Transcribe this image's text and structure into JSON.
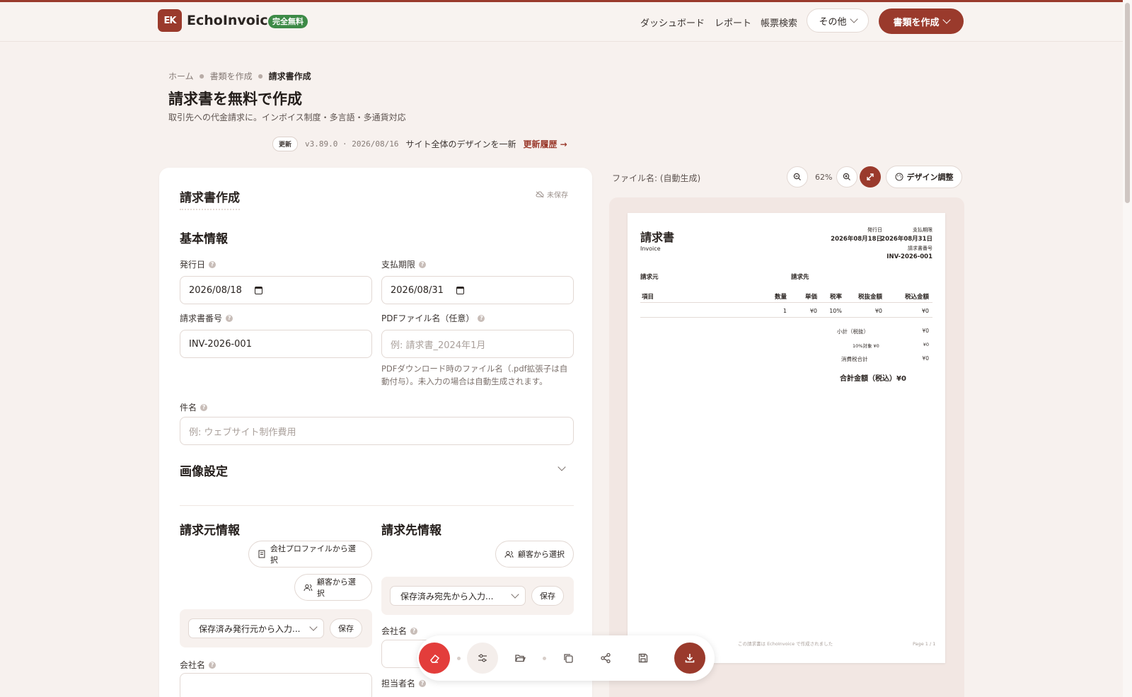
{
  "header": {
    "logo_mark": "EK",
    "brand": "EchoInvoice",
    "free_badge": "完全無料",
    "nav": [
      "ダッシュボード",
      "レポート",
      "帳票検索"
    ],
    "other_label": "その他",
    "create_label": "書類を作成"
  },
  "breadcrumb": [
    "ホーム",
    "書類を作成",
    "請求書作成"
  ],
  "page": {
    "title": "請求書を無料で作成",
    "subtitle": "取引先への代金請求に。インボイス制度・多言語・多通貨対応"
  },
  "update": {
    "badge": "更新",
    "version": "v3.89.0 · 2026/08/16",
    "message": "サイト全体のデザインを一新",
    "link": "更新履歴 →"
  },
  "form": {
    "card_title": "請求書作成",
    "unsaved": "未保存",
    "basic_section": "基本情報",
    "issue_date_label": "発行日",
    "issue_date": "2026/08/18",
    "due_date_label": "支払期限",
    "due_date": "2026/08/31",
    "invoice_no_label": "請求書番号",
    "invoice_no": "INV-2026-001",
    "pdf_name_label": "PDFファイル名（任意）",
    "pdf_name_placeholder": "例: 請求書_2024年1月",
    "pdf_hint": "PDFダウンロード時のファイル名（.pdf拡張子は自動付与）。未入力の場合は自動生成されます。",
    "subject_label": "件名",
    "subject_placeholder": "例: ウェブサイト制作費用",
    "image_section": "画像設定",
    "sender_section": "請求元情報",
    "recipient_section": "請求先情報",
    "company_profile_btn": "会社プロファイルから選択",
    "customer_btn": "顧客から選択",
    "saved_sender": "保存済み発行元から入力...",
    "saved_recipient": "保存済み宛先から入力...",
    "save": "保存",
    "company_name_label": "会社名",
    "contact_label": "担当者名"
  },
  "preview": {
    "filename": "ファイル名: (自動生成)",
    "zoom": "62%",
    "design_btn": "デザイン調整",
    "doc_title": "請求書",
    "doc_sub": "Invoice",
    "issue_label": "発行日",
    "issue_value": "2026年08月18日",
    "due_label": "支払期限",
    "due_value": "2026年08月31日",
    "no_label": "請求書番号",
    "no_value": "INV-2026-001",
    "from_label": "請求元",
    "to_label": "請求先",
    "columns": [
      "項目",
      "数量",
      "単価",
      "税率",
      "税抜金額",
      "税込金額"
    ],
    "row": [
      "",
      "1",
      "¥0",
      "10%",
      "¥0",
      "¥0"
    ],
    "subtotal_label": "小計（税抜）",
    "subtotal_value": "¥0",
    "tax10_label": "10%対象 ¥0",
    "tax10_value": "¥0",
    "tax_total_label": "消費税合計",
    "tax_total_value": "¥0",
    "grand_label": "合計金額（税込）¥0",
    "footer_note": "この請求書は EchoInvoice で作成されました",
    "page": "Page 1 / 1"
  },
  "colors": {
    "brand": "#9a3a2c",
    "free_badge": "#3d8a47",
    "toolbar_red": "#e33d3b",
    "background": "#f7f1ee"
  }
}
